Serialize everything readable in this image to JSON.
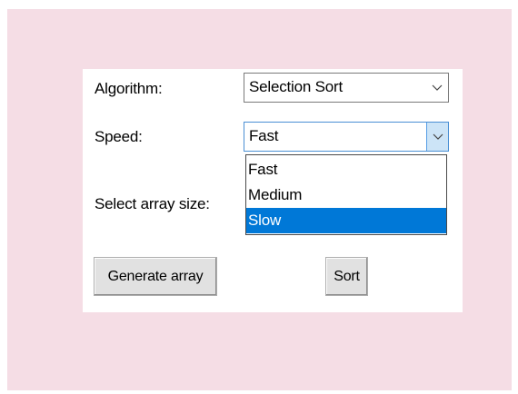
{
  "form": {
    "algorithm_label": "Algorithm:",
    "algorithm_value": "Selection Sort",
    "speed_label": "Speed:",
    "speed_value": "Fast",
    "array_size_label": "Select array size:",
    "speed_options": [
      "Fast",
      "Medium",
      "Slow"
    ],
    "highlighted_option": "Slow"
  },
  "buttons": {
    "generate_label": "Generate array",
    "sort_label": "Sort"
  },
  "colors": {
    "background": "#f5dde5",
    "highlight": "#0078d7"
  },
  "icons": {
    "combo_arrow": "chevron-down-icon"
  }
}
